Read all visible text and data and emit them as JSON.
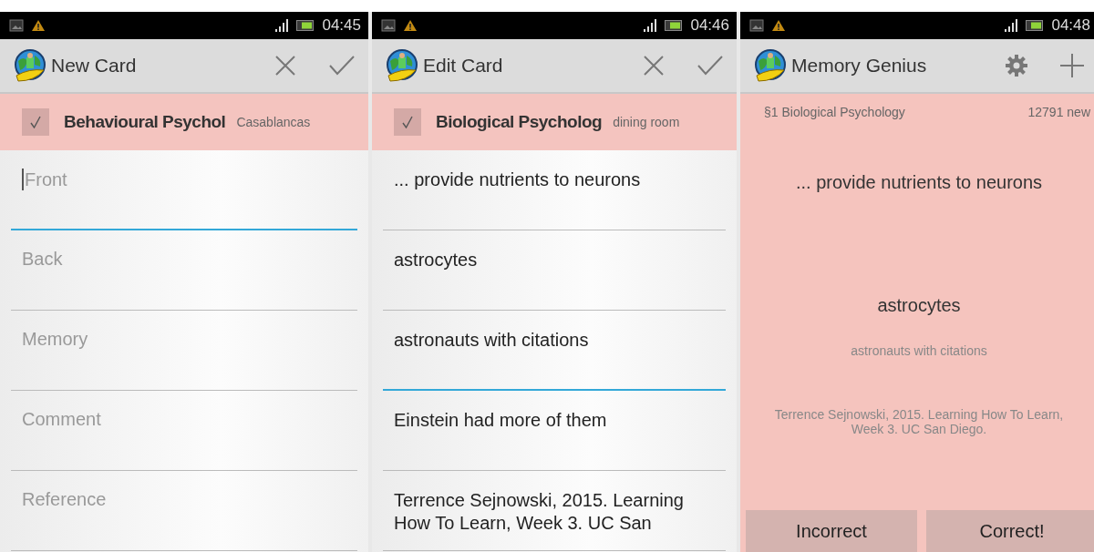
{
  "screens": [
    {
      "status_bar": {
        "time": "04:45"
      },
      "action_bar": {
        "title": "New Card",
        "actions": [
          {
            "kind": "cancel"
          },
          {
            "kind": "confirm"
          }
        ]
      },
      "body": {
        "kind": "editor",
        "deck": {
          "checked": true,
          "name": "Behavioural Psychol",
          "tag": "Casablancas"
        },
        "fields": [
          {
            "placeholder": "Front",
            "focused": true
          },
          {
            "placeholder": "Back",
            "focused": false
          },
          {
            "placeholder": "Memory",
            "focused": false
          },
          {
            "placeholder": "Comment",
            "focused": false
          },
          {
            "placeholder": "Reference",
            "focused": false
          }
        ]
      }
    },
    {
      "status_bar": {
        "time": "04:46"
      },
      "action_bar": {
        "title": "Edit Card",
        "actions": [
          {
            "kind": "cancel"
          },
          {
            "kind": "confirm"
          }
        ]
      },
      "body": {
        "kind": "editor",
        "deck": {
          "checked": true,
          "name": "Biological Psycholog",
          "tag": "dining room"
        },
        "fields": [
          {
            "value": "... provide nutrients to neurons",
            "focused": false
          },
          {
            "value": "astrocytes",
            "focused": false
          },
          {
            "value": "astronauts with citations",
            "focused": true
          },
          {
            "value": "Einstein had more of them",
            "focused": false
          },
          {
            "value": "Terrence Sejnowski, 2015. Learning How To Learn, Week 3. UC San",
            "focused": false
          }
        ]
      }
    },
    {
      "status_bar": {
        "time": "04:48"
      },
      "action_bar": {
        "title": "Memory Genius",
        "actions": [
          {
            "kind": "settings"
          },
          {
            "kind": "add"
          }
        ]
      },
      "body": {
        "kind": "review",
        "section": "§1 Biological Psychology",
        "count": "12791 new",
        "front": "... provide nutrients to neurons",
        "back": "astrocytes",
        "memory": "astronauts with citations",
        "reference": "Terrence Sejnowski, 2015. Learning How To Learn, Week 3. UC San Diego.",
        "buttons": [
          "Incorrect",
          "Correct!"
        ]
      }
    }
  ]
}
